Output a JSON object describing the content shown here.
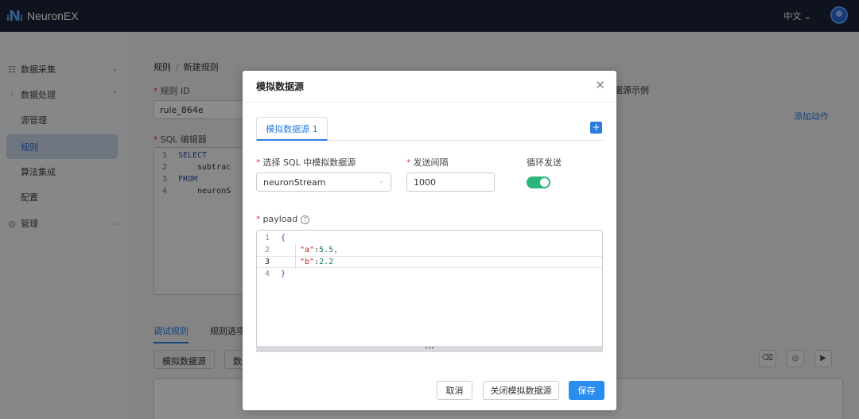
{
  "app": {
    "name": "NeuronEX",
    "lang": "中文"
  },
  "sidebar": {
    "items": [
      {
        "label": "数据采集",
        "icon": "data-collect-icon"
      },
      {
        "label": "数据处理",
        "icon": "data-process-icon"
      },
      {
        "label": "源管理"
      },
      {
        "label": "规则"
      },
      {
        "label": "算法集成"
      },
      {
        "label": "配置"
      },
      {
        "label": "管理",
        "icon": "settings-icon"
      }
    ]
  },
  "breadcrumb": {
    "parent": "规则",
    "current": "新建规则"
  },
  "rule": {
    "id_label": "规则 ID",
    "id_value": "rule_864e",
    "sql_label": "SQL 编辑器",
    "sql_lines": [
      "SELECT",
      "subtrac",
      "FROM",
      "neuronS"
    ],
    "sql_nums": [
      "1",
      "2",
      "3",
      "4"
    ]
  },
  "page": {
    "examples_label": "据源示例",
    "add_action": "添加动作",
    "tabs": [
      "调试规则",
      "规则选项"
    ],
    "mock_button": "模拟数据源",
    "data_button_partial": "数"
  },
  "modal": {
    "title": "模拟数据源",
    "tab_label": "模拟数据源 1",
    "select_label": "选择 SQL 中模拟数据源",
    "select_value": "neuronStream",
    "interval_label": "发送间隔",
    "interval_value": "1000",
    "loop_label": "循环发送",
    "loop_on": true,
    "payload_label": "payload",
    "payload_lines": [
      {
        "n": "1",
        "text": "{"
      },
      {
        "n": "2",
        "key": "\"a\"",
        "value": "5.5,"
      },
      {
        "n": "3",
        "key": "\"b\"",
        "value": "2.2"
      },
      {
        "n": "4",
        "text": "}"
      }
    ],
    "buttons": {
      "cancel": "取消",
      "close": "关闭模拟数据源",
      "save": "保存"
    }
  },
  "colors": {
    "primary": "#2b7de1",
    "toggle_on": "#2db57a",
    "topbar": "#1c2438"
  }
}
